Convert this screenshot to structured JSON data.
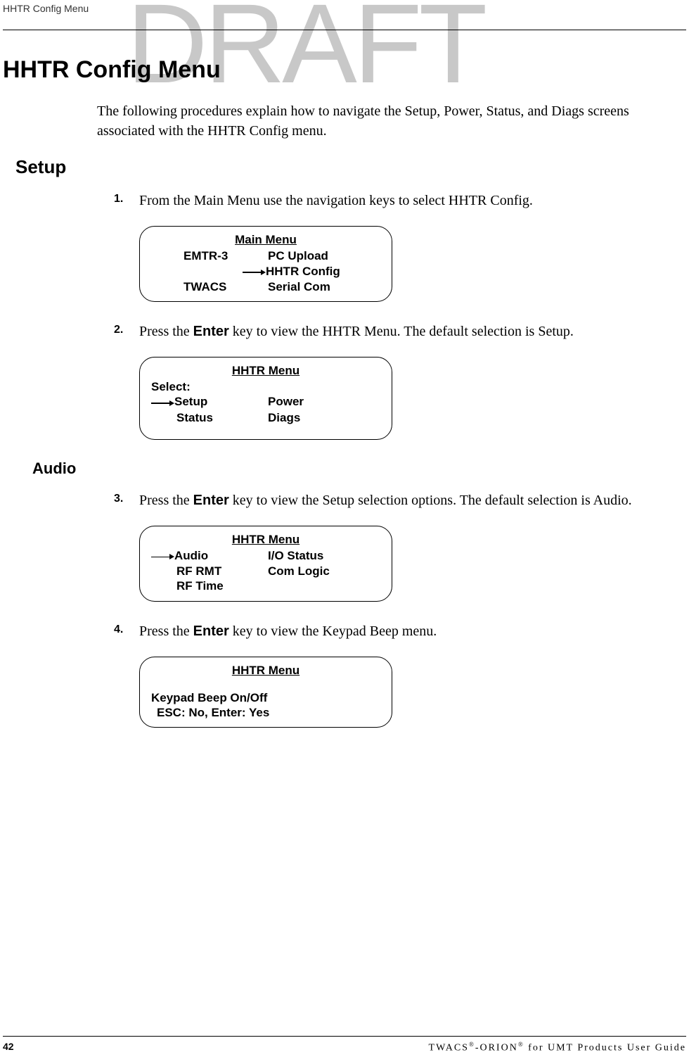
{
  "watermark": "DRAFT",
  "header_top": "HHTR Config Menu",
  "h1": "HHTR Config Menu",
  "intro": "The following procedures explain how to navigate the Setup, Power, Status, and Diags screens associated with the HHTR Config menu.",
  "setup_heading": "Setup",
  "audio_heading": "Audio",
  "steps": {
    "s1": {
      "num": "1.",
      "text": "From the Main Menu use the navigation keys to select HHTR Config."
    },
    "s2": {
      "num": "2.",
      "prefix": "Press the ",
      "key": "Enter",
      "suffix": " key to view the HHTR Menu. The default selection is Setup."
    },
    "s3": {
      "num": "3.",
      "prefix": "Press the ",
      "key": "Enter",
      "suffix": " key to view the Setup selection options. The default selection is Audio."
    },
    "s4": {
      "num": "4.",
      "prefix": "Press the ",
      "key": "Enter",
      "suffix": " key to view the Keypad Beep menu."
    }
  },
  "lcd1": {
    "title": "Main Menu",
    "r1c1": "EMTR-3",
    "r1c2": "PC Upload",
    "r2c2": "HHTR Config",
    "r3c1": "TWACS",
    "r3c2": "Serial Com"
  },
  "lcd2": {
    "title": "HHTR Menu",
    "select": "Select:",
    "r1c1": "Setup",
    "r1c2": "Power",
    "r2c1": "Status",
    "r2c2": "Diags"
  },
  "lcd3": {
    "title": "HHTR Menu",
    "r1c1": "Audio",
    "r1c2": "I/O Status",
    "r2c1": "RF RMT",
    "r2c2": "Com Logic",
    "r3c1": "RF Time"
  },
  "lcd4": {
    "title": "HHTR Menu",
    "line1": "Keypad Beep On/Off",
    "line2": "ESC: No,  Enter: Yes"
  },
  "footer": {
    "page": "42",
    "text_part1": "TWACS",
    "reg1": "®",
    "text_part2": "-ORION",
    "reg2": "®",
    "text_part3": " for UMT Products User Guide"
  }
}
